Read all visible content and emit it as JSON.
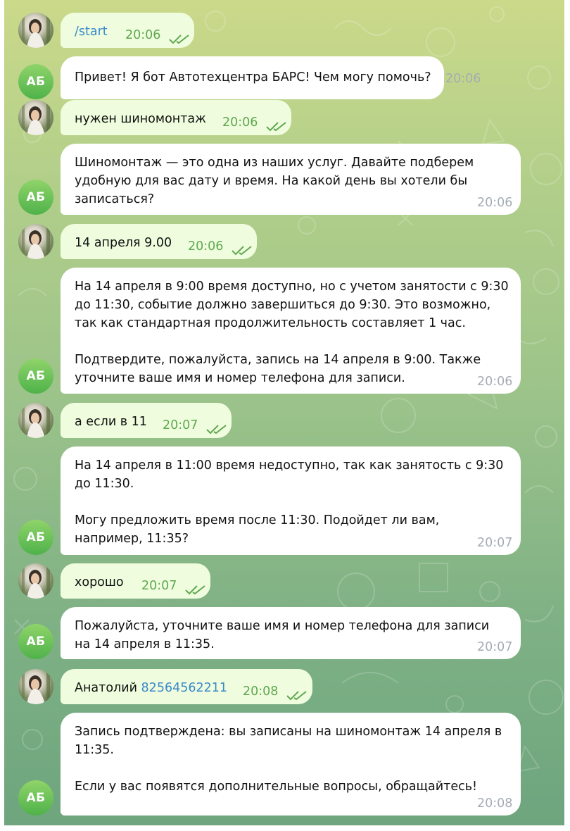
{
  "bot_avatar_initials": "АБ",
  "messages": [
    {
      "dir": "out",
      "text": "",
      "link": "/start",
      "time": "20:06"
    },
    {
      "dir": "in",
      "text": "Привет! Я бот Автотехцентра БАРС! Чем могу помочь?",
      "time": "20:06"
    },
    {
      "dir": "out",
      "text": "нужен шиномонтаж",
      "time": "20:06"
    },
    {
      "dir": "in",
      "text": "Шиномонтаж — это одна из наших услуг. Давайте подберем\nудобную для вас дату и время. На какой день вы хотели бы\nзаписаться?",
      "time": "20:06"
    },
    {
      "dir": "out",
      "text": "14 апреля 9.00",
      "time": "20:06"
    },
    {
      "dir": "in",
      "text": "На 14 апреля в 9:00 время доступно, но с учетом занятости с 9:30\nдо 11:30, событие должно завершиться до 9:30. Это возможно,\nтак как стандартная продолжительность составляет 1 час.\n\nПодтвердите, пожалуйста, запись на 14 апреля в 9:00. Также\nуточните ваше имя и номер телефона для записи.",
      "time": "20:06"
    },
    {
      "dir": "out",
      "text": "а если в 11",
      "time": "20:07"
    },
    {
      "dir": "in",
      "text": "На 14 апреля в 11:00 время недоступно, так как занятость с 9:30\nдо 11:30.\n\nМогу предложить время после 11:30. Подойдет ли вам,\nнапример, 11:35?",
      "time": "20:07"
    },
    {
      "dir": "out",
      "text": "хорошо",
      "time": "20:07"
    },
    {
      "dir": "in",
      "text": "Пожалуйста, уточните ваше имя и номер телефона для записи\nна 14 апреля в 11:35.",
      "time": "20:07"
    },
    {
      "dir": "out",
      "text": "Анатолий ",
      "link": "82564562211",
      "time": "20:08"
    },
    {
      "dir": "in",
      "text": "Запись подтверждена: вы записаны на шиномонтаж 14 апреля в\n11:35.\n\nЕсли у вас появятся дополнительные вопросы, обращайтесь!",
      "time": "20:08"
    }
  ]
}
